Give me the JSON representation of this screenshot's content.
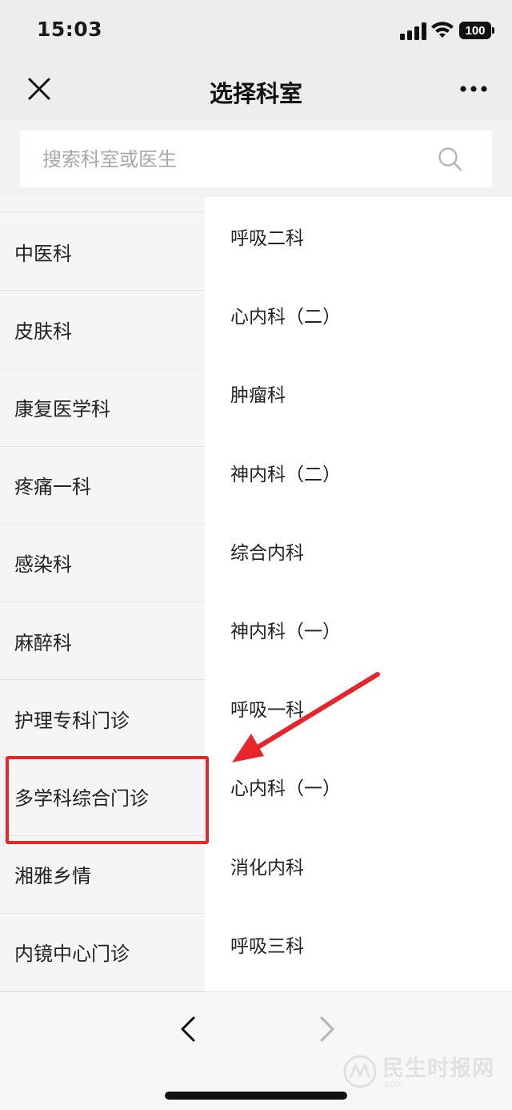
{
  "status_bar": {
    "time": "15:03",
    "battery": "100",
    "icons": [
      "signal-icon",
      "wifi-icon",
      "battery-icon"
    ]
  },
  "nav": {
    "title": "选择科室",
    "close_icon": "close-icon",
    "more_icon": "more-icon"
  },
  "search": {
    "placeholder": "搜索科室或医生",
    "value": "",
    "icon": "search-icon"
  },
  "left_departments": [
    "中医科",
    "皮肤科",
    "康复医学科",
    "疼痛一科",
    "感染科",
    "麻醉科",
    "护理专科门诊",
    "多学科综合门诊",
    "湘雅乡情",
    "内镜中心门诊"
  ],
  "right_departments": [
    "呼吸二科",
    "心内科（二）",
    "肿瘤科",
    "神内科（二）",
    "综合内科",
    "神内科（一）",
    "呼吸一科",
    "心内科（一）",
    "消化内科",
    "呼吸三科"
  ],
  "toolbar": {
    "back_icon": "chevron-left-icon",
    "forward_icon": "chevron-right-icon"
  },
  "watermark": {
    "text": "民生时报网",
    "sub": ".com"
  },
  "colors": {
    "background": "#ededed",
    "left_column": "#f5f5f5",
    "annotation_red": "#e8252b"
  }
}
